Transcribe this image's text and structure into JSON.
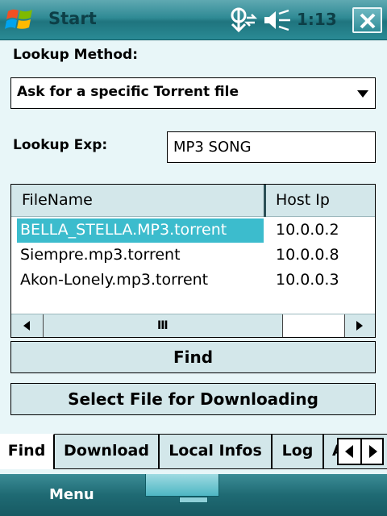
{
  "titlebar": {
    "title": "Start",
    "clock": "1:13",
    "icons": [
      "windows-flag-icon",
      "connectivity-icon",
      "volume-icon",
      "close-icon"
    ]
  },
  "form": {
    "lookup_method_label": "Lookup Method:",
    "lookup_method_value": "Ask for a specific Torrent file",
    "lookup_exp_label": "Lookup Exp:",
    "lookup_exp_value": "MP3 SONG"
  },
  "listview": {
    "columns": [
      "FileName",
      "Host Ip"
    ],
    "rows": [
      {
        "filename": "BELLA_STELLA.MP3.torrent",
        "host_ip": "10.0.0.2",
        "selected": true
      },
      {
        "filename": "Siempre.mp3.torrent",
        "host_ip": "10.0.0.8",
        "selected": false
      },
      {
        "filename": "Akon-Lonely.mp3.torrent",
        "host_ip": "10.0.0.3",
        "selected": false
      }
    ],
    "scroll_grip": "III"
  },
  "buttons": {
    "find": "Find",
    "select_file": "Select File for Downloading"
  },
  "tabs": [
    {
      "label": "Find",
      "active": true
    },
    {
      "label": "Download",
      "active": false
    },
    {
      "label": "Local Infos",
      "active": false
    },
    {
      "label": "Log",
      "active": false
    },
    {
      "label": "A",
      "active": false
    }
  ],
  "menubar": {
    "left_softkey": "Menu"
  },
  "colors": {
    "selection": "#3cbccd",
    "background": "#e8f6f8",
    "titlebar": "#2f8a94"
  }
}
